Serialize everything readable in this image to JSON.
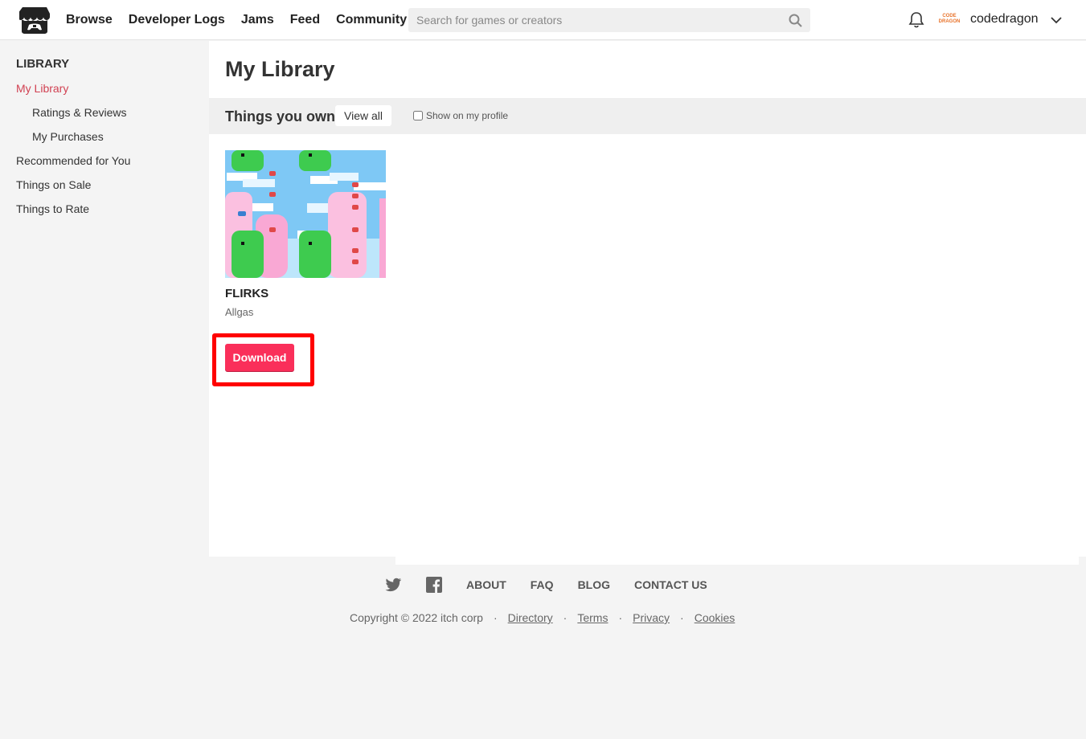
{
  "header": {
    "nav": [
      {
        "label": "Browse"
      },
      {
        "label": "Developer Logs"
      },
      {
        "label": "Jams"
      },
      {
        "label": "Feed"
      },
      {
        "label": "Community"
      }
    ],
    "search_placeholder": "Search for games or creators",
    "avatar_text": "CODE DRAGON",
    "username": "codedragon"
  },
  "sidebar": {
    "heading": "LIBRARY",
    "items": [
      {
        "label": "My Library",
        "active": true
      },
      {
        "label": "Ratings & Reviews"
      },
      {
        "label": "My Purchases"
      },
      {
        "label": "Recommended for You"
      },
      {
        "label": "Things on Sale"
      },
      {
        "label": "Things to Rate"
      }
    ]
  },
  "main": {
    "title": "My Library",
    "section_title": "Things you own",
    "view_all_label": "View all",
    "show_on_profile_label": "Show on my profile",
    "games": [
      {
        "title": "FLIRKS",
        "author": "Allgas",
        "download_label": "Download"
      }
    ]
  },
  "footer": {
    "links": [
      "ABOUT",
      "FAQ",
      "BLOG",
      "CONTACT US"
    ],
    "copyright": "Copyright © 2022 itch corp",
    "legal_links": [
      "Directory",
      "Terms",
      "Privacy",
      "Cookies"
    ],
    "separator": "·"
  },
  "colors": {
    "accent": "#fa2f5a",
    "active_link": "#d14152",
    "highlight": "#ff0000"
  }
}
